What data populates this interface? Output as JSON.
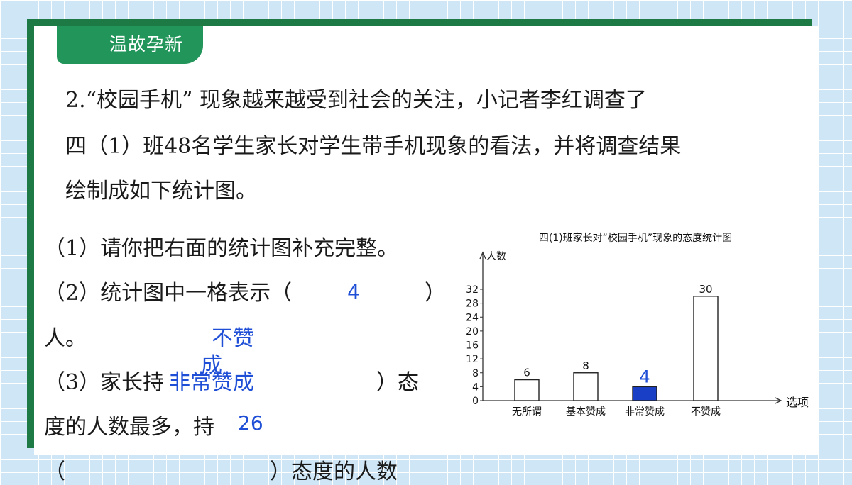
{
  "header": {
    "title": "温故孕新"
  },
  "question": {
    "line1": "2.“校园手机” 现象越来越受到社会的关注，小记者李红调查了",
    "line2": "四（1）班48名学生家长对学生带手机现象的看法，并将调查结果",
    "line3": "绘制成如下统计图。",
    "sub1": "（1）请你把右面的统计图补充完整。",
    "sub2_a": "（2）统计图中一格表示（",
    "sub2_b": "）",
    "sub2_c": "人。",
    "sub3_a": "（3）家长持",
    "sub3_b": "）态",
    "sub3_c": "度的人数最多，持",
    "sub3_d": "（",
    "sub3_e": "）态度的人数"
  },
  "answers": {
    "a2": "4",
    "a3_1a": "不赞",
    "a3_1b": "成",
    "a3_2": "非常赞成",
    "a3_3": "26"
  },
  "chart_data": {
    "type": "bar",
    "title": "四(1)班家长对“校园手机”现象的态度统计图",
    "ylabel": "人数",
    "xlabel": "选项",
    "categories": [
      "无所谓",
      "基本赞成",
      "非常赞成",
      "不赞成"
    ],
    "values": [
      6,
      8,
      4,
      30
    ],
    "value_labels": [
      "6",
      "8",
      "4",
      "30"
    ],
    "highlighted_index": 2,
    "highlight_color": "#1a3fc7",
    "yticks": [
      0,
      4,
      8,
      12,
      16,
      20,
      24,
      28,
      32
    ],
    "ylim": [
      0,
      32
    ]
  }
}
